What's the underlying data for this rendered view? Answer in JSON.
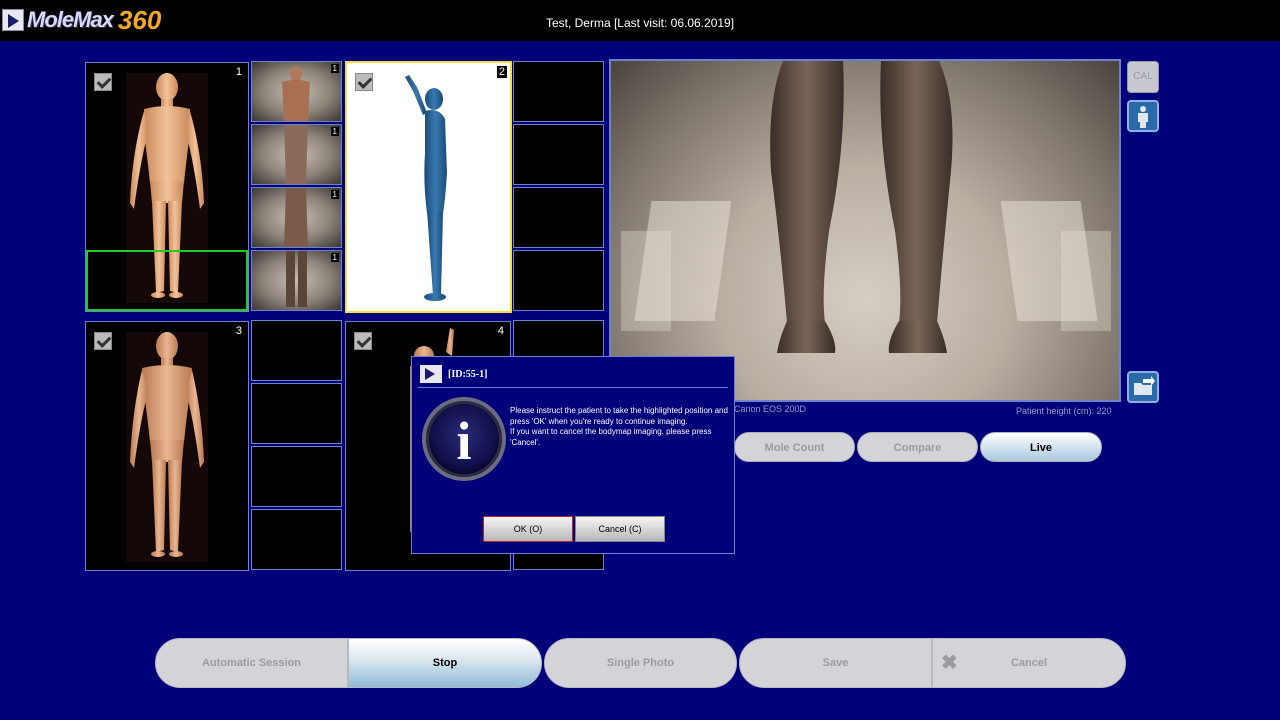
{
  "app": {
    "logo_text": "MoleMax",
    "logo_number": "360"
  },
  "header": {
    "patient_title": "Test, Derma [Last visit: 06.06.2019]"
  },
  "bodymap": {
    "panels": [
      {
        "number": "1",
        "checked": true,
        "view": "front"
      },
      {
        "number": "2",
        "checked": true,
        "view": "side-arm-raised"
      },
      {
        "number": "3",
        "checked": true,
        "view": "back"
      },
      {
        "number": "4",
        "checked": true,
        "view": "side-arm-raised"
      }
    ],
    "thumbnails": [
      {
        "number": "1"
      },
      {
        "number": "1"
      },
      {
        "number": "1"
      },
      {
        "number": "1"
      }
    ]
  },
  "camera": {
    "model": "Canon EOS 200D",
    "patient_height": "Patient height (cm): 220"
  },
  "side_tools": {
    "cal_label": "CAL",
    "body_icon": "body-figure-icon",
    "export_icon": "folder-export-icon"
  },
  "view_tabs": {
    "mole_count": "Mole Count",
    "compare": "Compare",
    "live": "Live"
  },
  "bottom_bar": {
    "automatic_session": "Automatic Session",
    "stop": "Stop",
    "single_photo": "Single Photo",
    "save": "Save",
    "cancel": "Cancel"
  },
  "dialog": {
    "id": "[ID:55-1]",
    "icon": "info-icon",
    "message_line1": "Please instruct the patient to take the highlighted position and press 'OK' when you're ready to continue imaging.",
    "message_line2": "If you want to cancel the bodymap imaging, please press 'Cancel'.",
    "ok_label": "OK (O)",
    "cancel_label": "Cancel (C)"
  },
  "colors": {
    "background": "#00007a",
    "accent_orange": "#f5a623",
    "panel_border": "#6b83c9",
    "highlight_green": "#22cc22",
    "highlight_yellow": "#f0e040"
  }
}
